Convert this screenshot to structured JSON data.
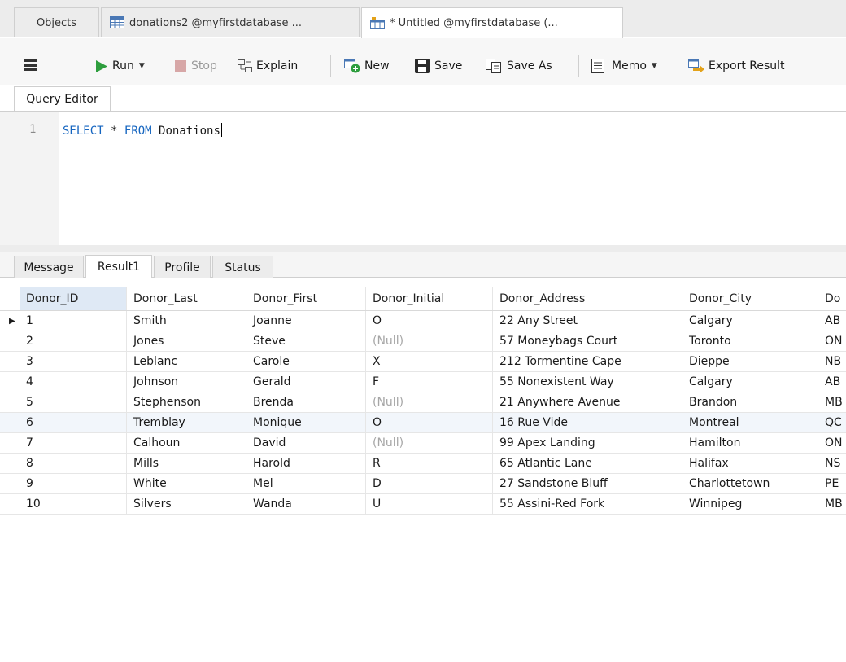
{
  "tabs": {
    "objects": "Objects",
    "donations2": "donations2 @myfirstdatabase ...",
    "untitled": "* Untitled @myfirstdatabase (..."
  },
  "toolbar": {
    "run": "Run",
    "stop": "Stop",
    "explain": "Explain",
    "new": "New",
    "save": "Save",
    "save_as": "Save As",
    "memo": "Memo",
    "export": "Export Result"
  },
  "editor": {
    "tab_label": "Query Editor",
    "line_number": "1",
    "kw_select": "SELECT",
    "star": "*",
    "kw_from": "FROM",
    "table": "Donations"
  },
  "result_tabs": [
    "Message",
    "Result1",
    "Profile",
    "Status"
  ],
  "grid": {
    "columns": [
      "Donor_ID",
      "Donor_Last",
      "Donor_First",
      "Donor_Initial",
      "Donor_Address",
      "Donor_City",
      "Do"
    ],
    "rows": [
      [
        "1",
        "Smith",
        "Joanne",
        "O",
        "22 Any Street",
        "Calgary",
        "AB"
      ],
      [
        "2",
        "Jones",
        "Steve",
        "(Null)",
        "57 Moneybags Court",
        "Toronto",
        "ON"
      ],
      [
        "3",
        "Leblanc",
        "Carole",
        "X",
        "212 Tormentine Cape",
        "Dieppe",
        "NB"
      ],
      [
        "4",
        "Johnson",
        "Gerald",
        "F",
        "55 Nonexistent Way",
        "Calgary",
        "AB"
      ],
      [
        "5",
        "Stephenson",
        "Brenda",
        "(Null)",
        "21 Anywhere Avenue",
        "Brandon",
        "MB"
      ],
      [
        "6",
        "Tremblay",
        "Monique",
        "O",
        "16 Rue Vide",
        "Montreal",
        "QC"
      ],
      [
        "7",
        "Calhoun",
        "David",
        "(Null)",
        "99 Apex Landing",
        "Hamilton",
        "ON"
      ],
      [
        "8",
        "Mills",
        "Harold",
        "R",
        "65 Atlantic Lane",
        "Halifax",
        "NS"
      ],
      [
        "9",
        "White",
        "Mel",
        "D",
        "27 Sandstone Bluff",
        "Charlottetown",
        "PE"
      ],
      [
        "10",
        "Silvers",
        "Wanda",
        "U",
        "55 Assini-Red Fork",
        "Winnipeg",
        "MB"
      ]
    ]
  },
  "colors": {
    "run": "#2e9e3e",
    "stop": "#d7a7a7",
    "keyword": "#1565c0",
    "null_text": "#a6a6a6",
    "selected_row": "#f2f6fb"
  }
}
